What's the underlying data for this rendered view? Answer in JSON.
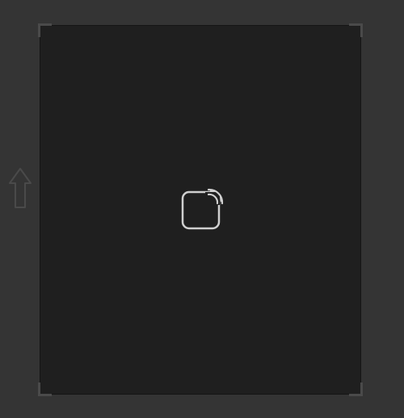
{
  "viewer": {
    "panel_color": "#1f1f1f",
    "background_color": "#343434",
    "center_icon": "cast-screen-icon",
    "side_icon": "up-arrow-icon"
  }
}
